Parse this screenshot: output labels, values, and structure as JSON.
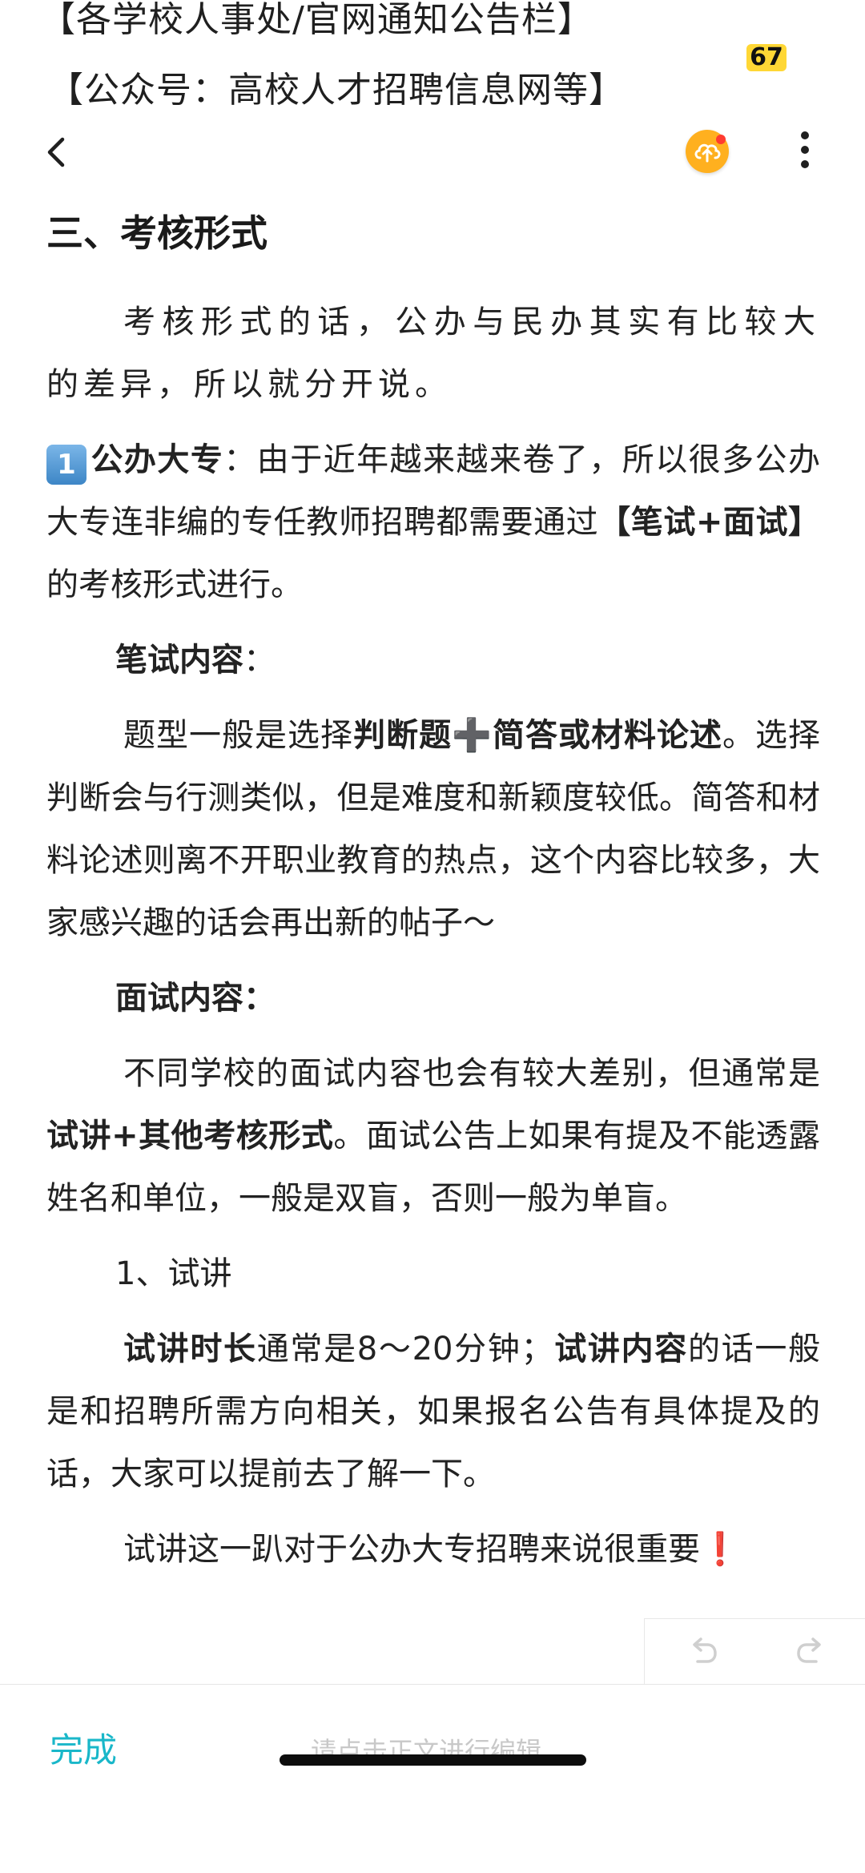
{
  "top_lines": {
    "line1": "【各学校人事处/官网通知公告栏】",
    "line2": "【公众号：高校人才招聘信息网等】"
  },
  "badge": {
    "count": "67",
    "color": "#ffd735"
  },
  "toolbar": {
    "back_icon": "chevron-left-icon",
    "upload_icon": "cloud-upload-icon",
    "more_icon": "more-vertical-icon",
    "accent": "#ffb01f"
  },
  "article": {
    "heading": "三、考核形式",
    "p1": "考核形式的话，公办与民办其实有比较大的差异，所以就分开说。",
    "p2": {
      "keycap": "1",
      "bold1": "公办大专",
      "text1": "：由于近年越来越来卷了，所以很多公办大专连非编的专任教师招聘都需要通过",
      "bold2": "【笔试+面试】",
      "text2": "的考核形式进行。"
    },
    "p3": {
      "bold": "笔试内容",
      "text": "："
    },
    "p4": {
      "text1": "题型一般是选择",
      "bold1": "判断题",
      "plus": "➕",
      "bold2": "简答或材料论述",
      "text2": "。选择判断会与行测类似，但是难度和新颖度较低。简答和材料论述则离不开职业教育的热点，这个内容比较多，大家感兴趣的话会再出新的帖子～"
    },
    "p5": {
      "bold": "面试内容："
    },
    "p6": {
      "text1": "不同学校的面试内容也会有较大差别，但通常是",
      "bold1": "试讲+其他考核形式",
      "text2": "。面试公告上如果有提及不能透露姓名和单位，一般是双盲，否则一般为单盲。"
    },
    "p7": "1、试讲",
    "p8": {
      "bold1": "试讲时长",
      "text1": "通常是8～20分钟；",
      "bold2": "试讲内容",
      "text2": "的话一般是和招聘所需方向相关，如果报名公告有具体提及的话，大家可以提前去了解一下。"
    },
    "p9": "试讲这一趴对于公办大专招聘来说很重要❗️"
  },
  "editor": {
    "done_label": "完成",
    "hint": "请点击正文进行编辑",
    "done_color": "#19b7c9"
  }
}
